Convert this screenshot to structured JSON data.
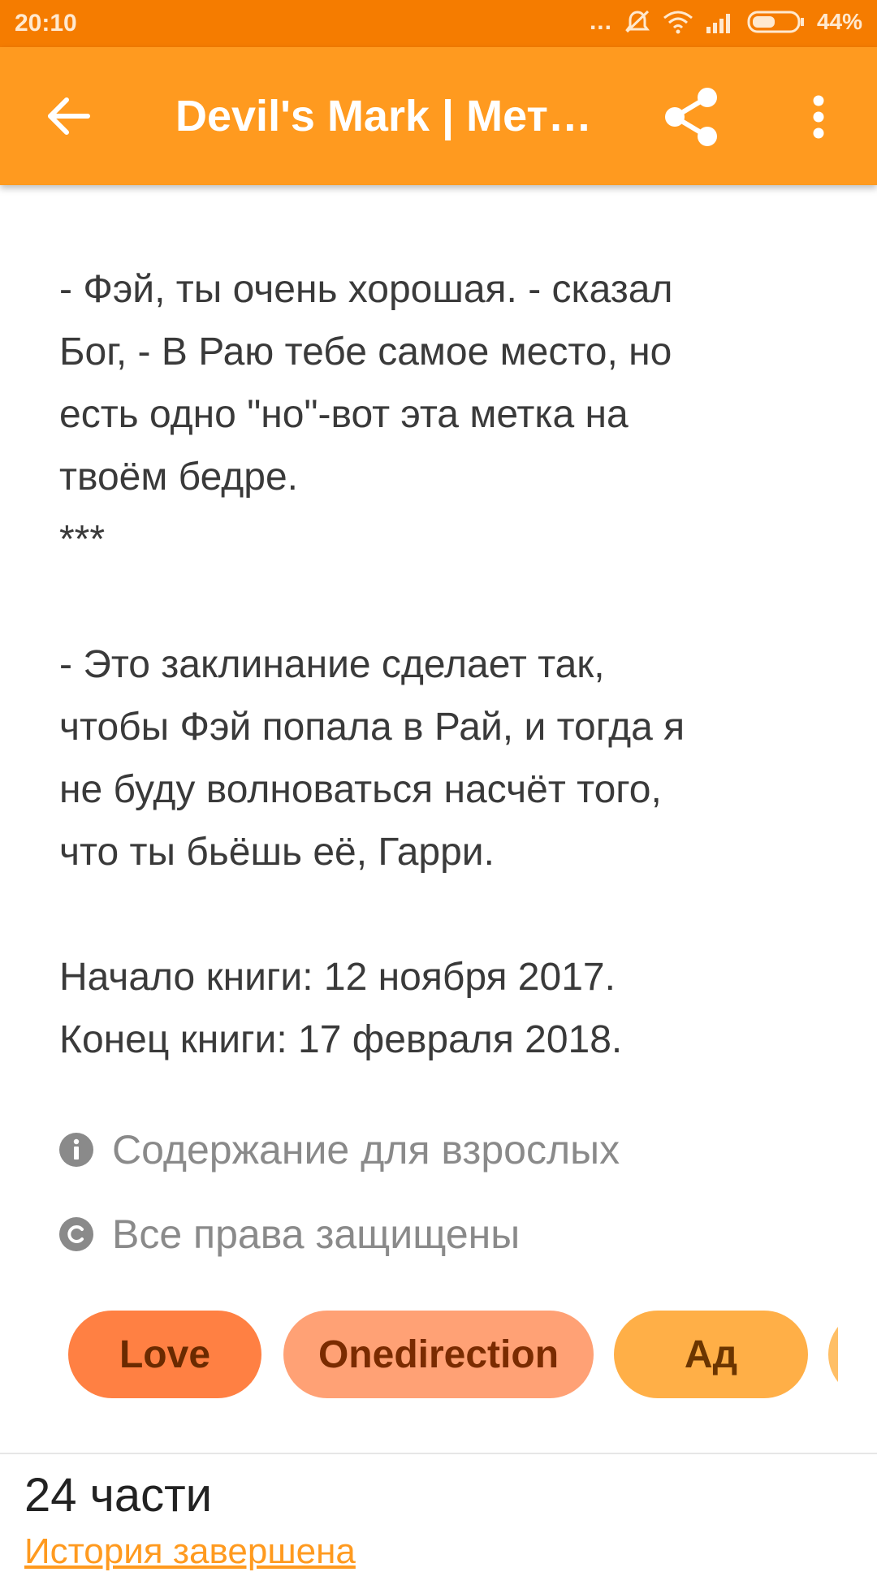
{
  "status_bar": {
    "time": "20:10",
    "dots": "...",
    "battery_percent": "44%",
    "icons": [
      "more-dots-icon",
      "mute-vibrate-icon",
      "wifi-icon",
      "signal-icon",
      "battery-icon"
    ]
  },
  "app_bar": {
    "title": "Devil's Mark | Метка Дьявола",
    "back_icon": "arrow-back-icon",
    "share_icon": "share-icon",
    "more_icon": "more-vert-icon",
    "color": "#ff9a1f"
  },
  "description": "- Фэй, ты очень хорошая. - сказал\nБог, - В Раю тебе самое место, но\nесть одно \"но\"-вот эта метка на\nтвоём бедре.\n***\n\n- Это заклинание сделает так,\nчтобы Фэй попала в Рай, и тогда я\nне буду волноваться насчёт того,\nчто ты бьёшь её, Гарри.\n\nНачало книги: 12 ноября 2017.\nКонец книги: 17 февраля 2018.",
  "info": {
    "mature": "Содержание для взрослых",
    "copyright": "Все права защищены"
  },
  "tags": [
    {
      "label": "Love",
      "color": "#ff8043"
    },
    {
      "label": "Onedirection",
      "color": "#ffa175"
    },
    {
      "label": "Ад",
      "color": "#ffaf47"
    },
    {
      "label": "",
      "color": "#ffbf66"
    }
  ],
  "parts": "24 части",
  "story_status": "История завершена"
}
